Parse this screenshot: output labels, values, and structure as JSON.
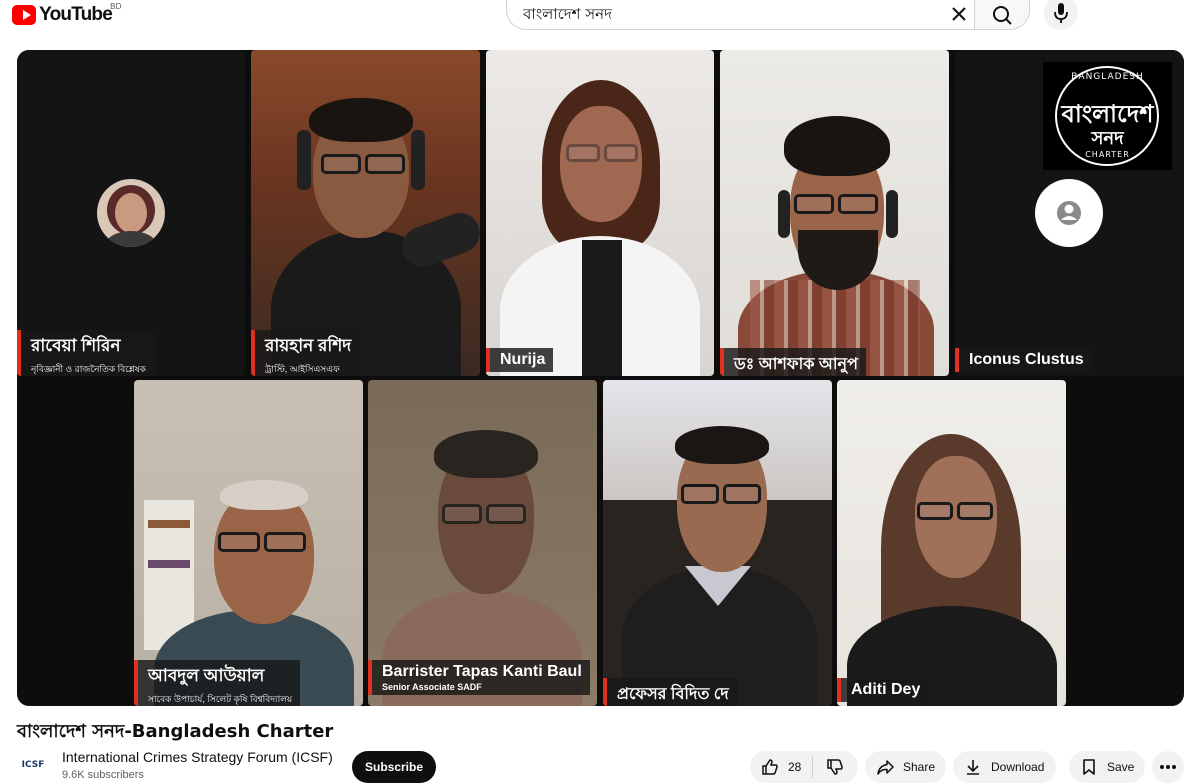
{
  "header": {
    "logo_text": "YouTube",
    "region": "BD",
    "search_value": "বাংলাদেশ সনদ",
    "clear_icon": "close-icon",
    "search_icon": "search-icon",
    "mic_icon": "mic-icon"
  },
  "video": {
    "channel_logo": {
      "top_text": "BANGLADESH",
      "bn_line1": "বাংলাদেশ",
      "bn_line2": "সনদ",
      "bottom_text": "CHARTER"
    },
    "participants": [
      {
        "name": "রাবেয়া শিরিন",
        "subtitle": "নৃবিজ্ঞানী ও রাজনৈতিক বিশ্লেষক"
      },
      {
        "name": "রায়হান রশিদ",
        "subtitle": "ট্রাস্টি, আইসিএসএফ"
      },
      {
        "name": "Nurija",
        "subtitle": ""
      },
      {
        "name": "ডঃ আশফাক আনুপ",
        "subtitle": ""
      },
      {
        "name": "Iconus Clustus",
        "subtitle": ""
      },
      {
        "name": "আবদুল আউয়াল",
        "subtitle": "সাবেক উপাচার্য, সিলেট কৃষি বিশ্ববিদ্যালয়"
      },
      {
        "name": "Barrister Tapas Kanti Baul",
        "subtitle": "Senior Associate SADF"
      },
      {
        "name": "প্রফেসর বিদিত দে",
        "subtitle": ""
      },
      {
        "name": "Aditi Dey",
        "subtitle": ""
      }
    ]
  },
  "title": "বাংলাদেশ সনদ-Bangladesh Charter",
  "channel": {
    "avatar_text": "ICSF",
    "name": "International Crimes Strategy Forum (ICSF)",
    "subscribers": "9.6K subscribers",
    "subscribe_label": "Subscribe"
  },
  "actions": {
    "likes": "28",
    "share": "Share",
    "download": "Download",
    "save": "Save"
  },
  "colors": {
    "brand": "#ff0000",
    "accent_bar": "#e0301e"
  }
}
